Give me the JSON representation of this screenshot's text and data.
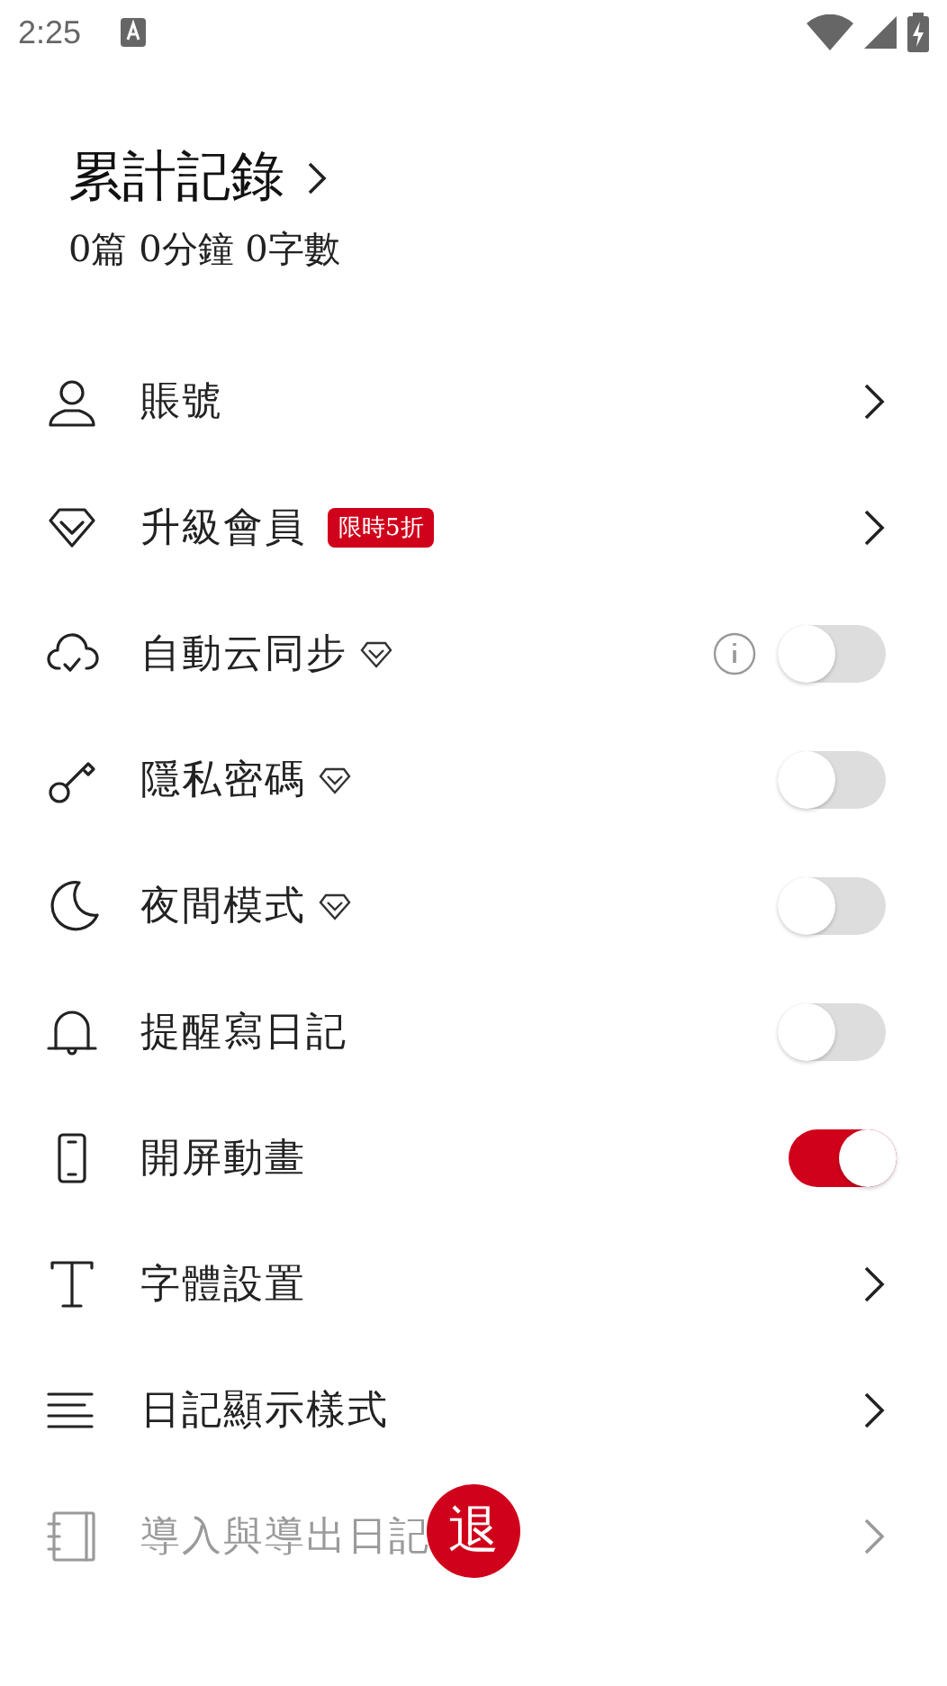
{
  "status_bar": {
    "time": "2:25"
  },
  "summary": {
    "title": "累計記錄",
    "stats": "0篇 0分鐘 0字數"
  },
  "settings": [
    {
      "kind": "link",
      "label": "賬號",
      "disabled": false
    },
    {
      "kind": "link",
      "label": "升級會員",
      "badge": "限時5折",
      "disabled": false
    },
    {
      "kind": "toggle",
      "label": "自動云同步",
      "premium": true,
      "info": true,
      "on": false,
      "disabled": false
    },
    {
      "kind": "toggle",
      "label": "隱私密碼",
      "premium": true,
      "on": false,
      "disabled": false
    },
    {
      "kind": "toggle",
      "label": "夜間模式",
      "premium": true,
      "on": false,
      "disabled": false
    },
    {
      "kind": "toggle",
      "label": "提醒寫日記",
      "on": false,
      "disabled": false
    },
    {
      "kind": "toggle",
      "label": "開屏動畫",
      "on": true,
      "disabled": false
    },
    {
      "kind": "link",
      "label": "字體設置",
      "disabled": false
    },
    {
      "kind": "link",
      "label": "日記顯示樣式",
      "disabled": false
    },
    {
      "kind": "link",
      "label": "導入與導出日記",
      "disabled": true
    }
  ],
  "floating_button": {
    "label": "退"
  }
}
